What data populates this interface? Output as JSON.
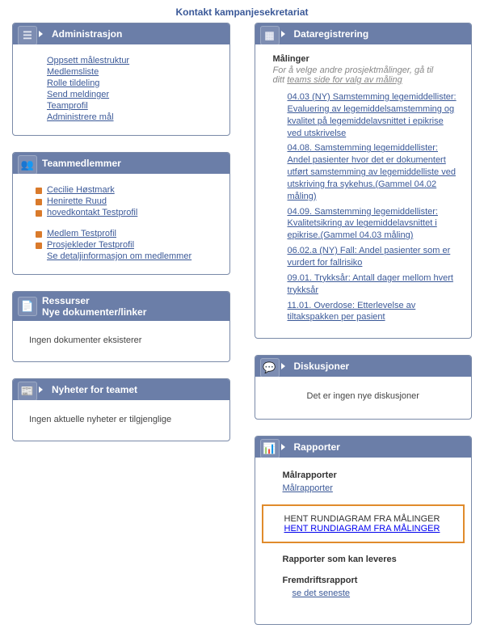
{
  "page_title": "Kontakt kampanjesekretariat",
  "admin": {
    "title": "Administrasjon",
    "links": [
      "Oppsett målestruktur",
      "Medlemsliste",
      "Rolle tildeling",
      "Send meldinger",
      "Teamprofil",
      "Administrere mål"
    ]
  },
  "team": {
    "title": "Teammedlemmer",
    "members": [
      "Cecilie Høstmark",
      "Henirette Ruud",
      "hovedkontakt Testprofil"
    ],
    "members2": [
      "Medlem Testprofil",
      "Prosjekleder Testprofil"
    ],
    "detail_link": "Se detaljinformasjon om medlemmer"
  },
  "resources": {
    "title_a": "Ressurser",
    "title_b": "Nye dokumenter/linker",
    "empty": "Ingen dokumenter eksisterer"
  },
  "news": {
    "title": "Nyheter for teamet",
    "empty": "Ingen aktuelle nyheter er tilgjenglige"
  },
  "datareg": {
    "title": "Dataregistrering",
    "subtitle": "Målinger",
    "note_a": "For å velge andre prosjektmålinger, gå til",
    "note_b": "ditt ",
    "note_link": "teams side for valg av måling",
    "links": [
      "04.03 (NY) Samstemming legemiddellister: Evaluering av legemiddelsamstemming og kvalitet på legemiddelavsnittet i epikrise ved utskrivelse",
      "04.08. Samstemming legemiddellister: Andel pasienter hvor det er dokumentert utført samstemming av legemiddelliste ved utskriving fra sykehus.(Gammel 04.02 måling)",
      "04.09. Samstemming legemiddellister: Kvalitetsikring av legemiddelavsnittet i epikrise.(Gammel 04.03 måling)",
      "06.02.a (NY) Fall: Andel pasienter som er vurdert for fallrisiko",
      "09.01. Trykksår: Antall dager mellom hvert trykksår",
      "11.01. Overdose: Etterlevelse av tiltakspakken per pasient"
    ]
  },
  "disc": {
    "title": "Diskusjoner",
    "empty": "Det er ingen nye diskusjoner"
  },
  "reports": {
    "title": "Rapporter",
    "sec1_title": "Målrapporter",
    "sec1_link": "Målrapporter",
    "sec2_title": "HENT RUNDIAGRAM FRA MÅLINGER",
    "sec2_link": "HENT RUNDIAGRAM FRA MÅLINGER",
    "sec3_title": "Rapporter som kan leveres",
    "sec4_title": "Fremdriftsrapport",
    "sec4_link": "se det seneste"
  }
}
